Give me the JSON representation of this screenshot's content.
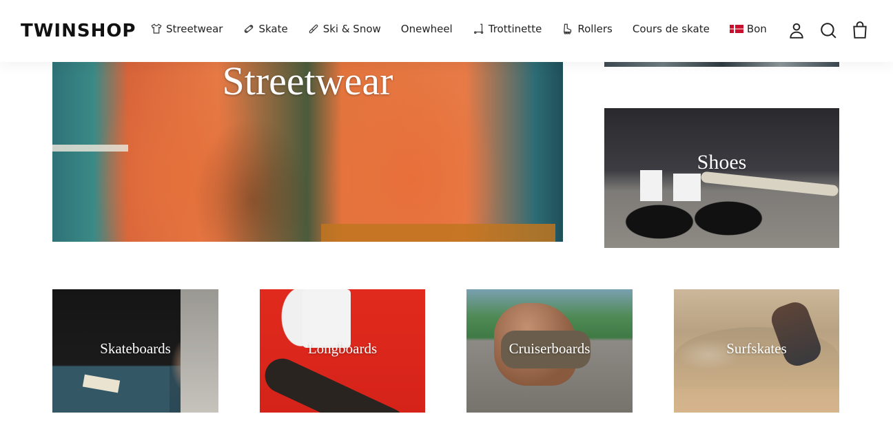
{
  "header": {
    "logo": "TWINSHOP",
    "nav": [
      {
        "label": "Streetwear",
        "icon": "tshirt-icon"
      },
      {
        "label": "Skate",
        "icon": "skateboard-icon"
      },
      {
        "label": "Ski & Snow",
        "icon": "ski-icon"
      },
      {
        "label": "Onewheel",
        "icon": ""
      },
      {
        "label": "Trottinette",
        "icon": "scooter-icon"
      },
      {
        "label": "Rollers",
        "icon": "roller-skate-icon"
      },
      {
        "label": "Cours de skate",
        "icon": ""
      },
      {
        "label": "Bon",
        "icon": "flag-icon"
      }
    ],
    "icons": [
      "account-icon",
      "search-icon",
      "shopping-bag-icon"
    ]
  },
  "categories": {
    "streetwear": "Streetwear",
    "shoes": "Shoes",
    "skateboards": "Skateboards",
    "longboards": "Longboards",
    "cruiserboards": "Cruiserboards",
    "surfskates": "Surfskates"
  }
}
